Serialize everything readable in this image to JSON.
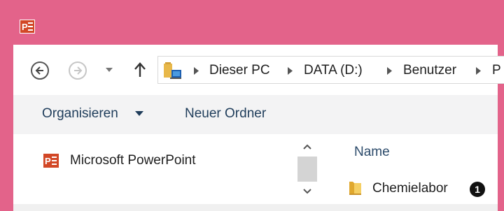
{
  "window": {
    "app_icon": "powerpoint-icon",
    "accent_color": "#e3638a"
  },
  "navigation": {
    "back_icon": "back-arrow-icon",
    "forward_icon": "forward-arrow-icon",
    "recent_icon": "chevron-down-icon",
    "up_icon": "up-arrow-icon"
  },
  "address_bar": {
    "location_icon": "this-pc-icon",
    "breadcrumbs": [
      "Dieser PC",
      "DATA (D:)",
      "Benutzer",
      "P"
    ]
  },
  "command_bar": {
    "organize_label": "Organisieren",
    "new_folder_label": "Neuer Ordner"
  },
  "nav_pane": {
    "items": [
      {
        "label": "Microsoft PowerPoint",
        "icon": "powerpoint-icon"
      }
    ]
  },
  "file_list": {
    "column_header": "Name",
    "items": [
      {
        "name": "Chemielabor",
        "icon": "folder-icon"
      }
    ]
  },
  "callout": {
    "number": "1"
  }
}
